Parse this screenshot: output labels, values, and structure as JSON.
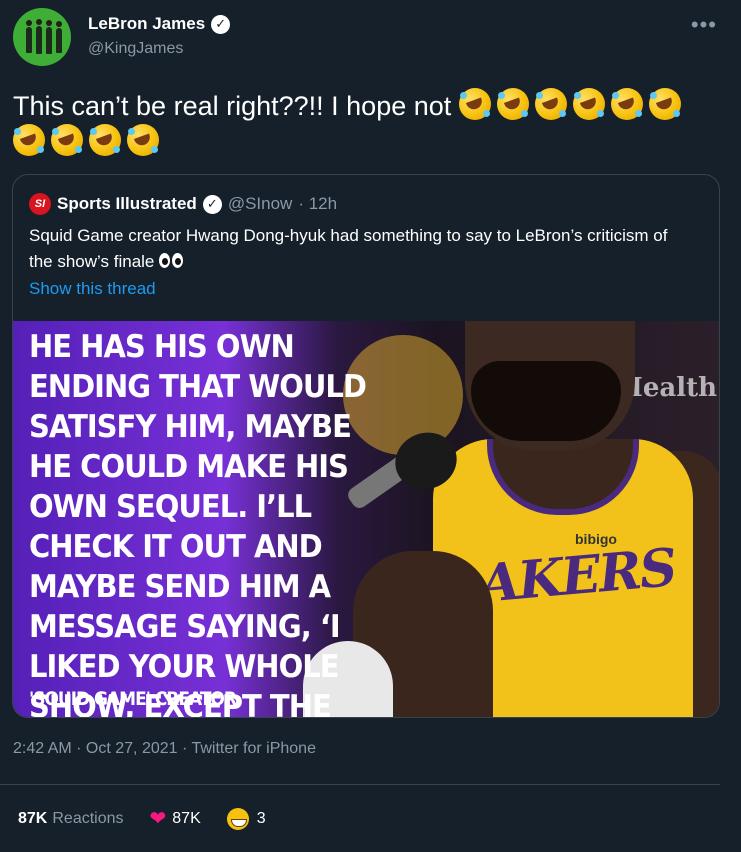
{
  "author": {
    "name": "LeBron James",
    "handle": "@KingJames"
  },
  "tweet": {
    "text": "This can’t be real right??!! I hope not",
    "emoji": "rolling-on-floor-laughing-emoji",
    "emoji_count": 10
  },
  "quote": {
    "logo_text": "SI",
    "name": "Sports Illustrated",
    "handle": "@SInow",
    "time": "· 12h",
    "text": "Squid Game creator Hwang Dong-hyuk had something to say to LeBron’s criticism of the show’s finale",
    "text_emoji": "eyes-emoji",
    "thread_link": "Show this thread",
    "image": {
      "overlay_text": "HE HAS HIS OWN ENDING THAT WOULD SATISFY HIM, MAYBE HE COULD MAKE HIS OWN SEQUEL. I’LL CHECK IT OUT AND MAYBE SEND HIM A MESSAGE SAYING, ‘I LIKED YOUR WHOLE SHOW, EXCEPT THE ENDING.’”",
      "overlay_caption": "'SQUID GAME' CREATOR",
      "jersey_text": "LAKERS",
      "sponsor_text": "bibigo",
      "background_text": "Health"
    }
  },
  "meta": {
    "timestamp": "2:42 AM · Oct 27, 2021 · Twitter for iPhone"
  },
  "reactions": {
    "total": "87K",
    "label": "Reactions",
    "likes": "87K",
    "grin_count": "3"
  },
  "colors": {
    "background": "#15202b",
    "link": "#1d9bf0",
    "secondary_text": "#8b98a5",
    "heart": "#f91880"
  }
}
